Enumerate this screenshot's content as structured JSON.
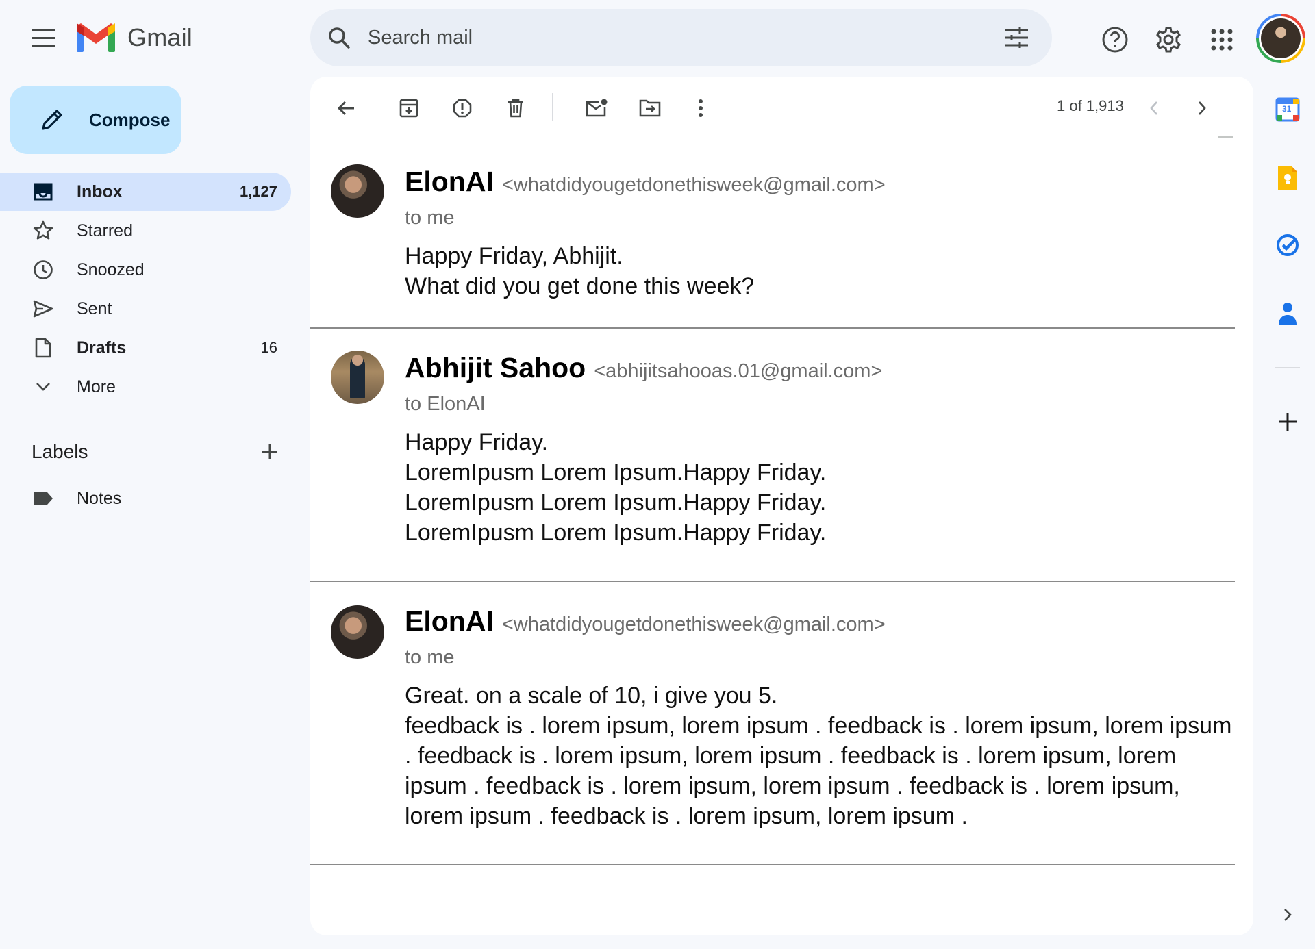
{
  "app": {
    "name": "Gmail"
  },
  "search": {
    "placeholder": "Search mail"
  },
  "compose": {
    "label": "Compose"
  },
  "nav": [
    {
      "label": "Inbox",
      "count": "1,127"
    },
    {
      "label": "Starred",
      "count": ""
    },
    {
      "label": "Snoozed",
      "count": ""
    },
    {
      "label": "Sent",
      "count": ""
    },
    {
      "label": "Drafts",
      "count": "16"
    },
    {
      "label": "More",
      "count": ""
    }
  ],
  "labels": {
    "title": "Labels",
    "items": [
      {
        "label": "Notes"
      }
    ]
  },
  "pager": {
    "text": "1 of 1,913"
  },
  "emails": [
    {
      "sender_name": "ElonAI",
      "sender_email": "<whatdidyougetdonethisweek@gmail.com>",
      "to": "to me",
      "body": [
        "Happy Friday, Abhijit.",
        "What did you get done this week?"
      ]
    },
    {
      "sender_name": "Abhijit Sahoo",
      "sender_email": "<abhijitsahooas.01@gmail.com>",
      "to": "to ElonAI",
      "body": [
        "Happy Friday.",
        "LoremIpusm Lorem Ipsum.Happy Friday.",
        "LoremIpusm Lorem Ipsum.Happy Friday.",
        "LoremIpusm Lorem Ipsum.Happy Friday."
      ]
    },
    {
      "sender_name": "ElonAI",
      "sender_email": "<whatdidyougetdonethisweek@gmail.com>",
      "to": "to me",
      "body": [
        "Great. on a scale of 10, i give you 5.",
        "feedback is . lorem ipsum, lorem ipsum . feedback is . lorem ipsum, lorem ipsum . feedback is . lorem ipsum, lorem ipsum . feedback is . lorem ipsum, lorem ipsum . feedback is . lorem ipsum, lorem ipsum . feedback is . lorem ipsum, lorem ipsum . feedback is . lorem ipsum, lorem ipsum ."
      ]
    }
  ],
  "side_apps": {
    "calendar_day": "31"
  },
  "colors": {
    "background": "#f6f8fc",
    "compose_bg": "#c2e7ff",
    "active_nav_bg": "#d3e3fd",
    "search_bg": "#e9eef6",
    "gmail_red": "#ea4335",
    "gmail_blue": "#4285f4",
    "gmail_green": "#34a853",
    "gmail_yellow": "#fbbc04"
  }
}
